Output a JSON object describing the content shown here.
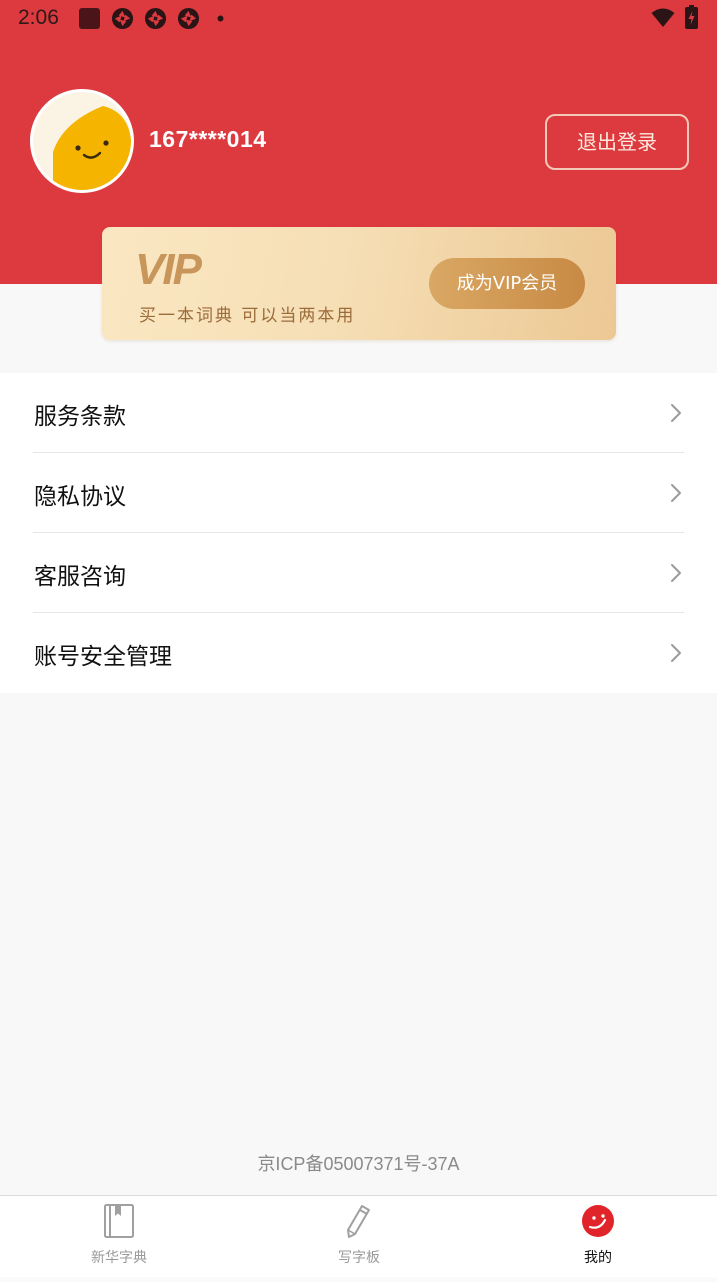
{
  "status_bar": {
    "time": "2:06"
  },
  "profile": {
    "username": "167****014",
    "logout_label": "退出登录"
  },
  "vip": {
    "logo_text": "VIP",
    "slogan": "买一本词典 可以当两本用",
    "button_label": "成为VIP会员"
  },
  "menu": {
    "items": [
      {
        "label": "服务条款",
        "icon": "chevron-right-icon"
      },
      {
        "label": "隐私协议",
        "icon": "chevron-right-icon"
      },
      {
        "label": "客服咨询",
        "icon": "chevron-right-icon"
      },
      {
        "label": "账号安全管理",
        "icon": "chevron-right-icon"
      }
    ]
  },
  "footer": {
    "icp": "京ICP备05007371号-37A"
  },
  "tabbar": {
    "tabs": [
      {
        "label": "新华字典",
        "icon": "book-icon",
        "active": false
      },
      {
        "label": "写字板",
        "icon": "pencil-icon",
        "active": false
      },
      {
        "label": "我的",
        "icon": "smiley-icon",
        "active": true
      }
    ]
  },
  "colors": {
    "header_red": "#dd3a3f",
    "vip_gold": "#c88a45",
    "active_tab_red": "#e0242a",
    "inactive_tab_gray": "#9a9a9a"
  }
}
